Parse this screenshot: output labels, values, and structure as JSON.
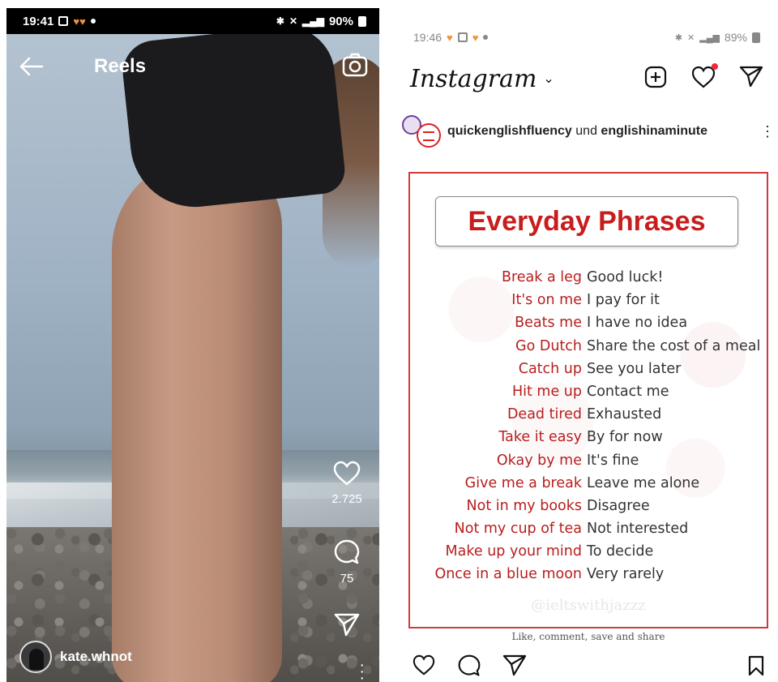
{
  "left": {
    "status": {
      "time": "19:41",
      "battery": "90%"
    },
    "header": {
      "title": "Reels"
    },
    "likes_count": "2.725",
    "comments_count": "75",
    "username": "kate.whnot"
  },
  "right": {
    "status": {
      "time": "19:46",
      "battery": "89%"
    },
    "app_title": "Instagram",
    "post_header": {
      "account1": "quickenglishfluency",
      "connector": "und",
      "account2": "englishinaminute"
    },
    "post": {
      "title": "Everyday Phrases",
      "phrases": [
        {
          "phrase": "Break a leg",
          "meaning": "Good luck!"
        },
        {
          "phrase": "It's on me",
          "meaning": "I pay for it"
        },
        {
          "phrase": "Beats me",
          "meaning": "I have no idea"
        },
        {
          "phrase": "Go Dutch",
          "meaning": "Share the cost of a meal"
        },
        {
          "phrase": "Catch up",
          "meaning": "See you later"
        },
        {
          "phrase": "Hit me up",
          "meaning": "Contact me"
        },
        {
          "phrase": "Dead tired",
          "meaning": "Exhausted"
        },
        {
          "phrase": "Take it easy",
          "meaning": "By for now"
        },
        {
          "phrase": "Okay by me",
          "meaning": "It's fine"
        },
        {
          "phrase": "Give me a break",
          "meaning": "Leave me alone"
        },
        {
          "phrase": "Not in my books",
          "meaning": "Disagree"
        },
        {
          "phrase": "Not my cup of tea",
          "meaning": "Not interested"
        },
        {
          "phrase": "Make up your mind",
          "meaning": "To decide"
        },
        {
          "phrase": "Once in a blue moon",
          "meaning": "Very rarely"
        }
      ],
      "watermark": "@ieltswithjazzz",
      "caption": "Like, comment, save and share"
    }
  },
  "colors": {
    "accent_red": "#c81d1d",
    "notification": "#ed2a43",
    "heart_orange": "#f0923a"
  },
  "icons": [
    "back-arrow-icon",
    "camera-icon",
    "heart-icon",
    "comment-icon",
    "send-icon",
    "more-icon",
    "new-post-icon",
    "bookmark-icon",
    "chevron-down-icon"
  ]
}
